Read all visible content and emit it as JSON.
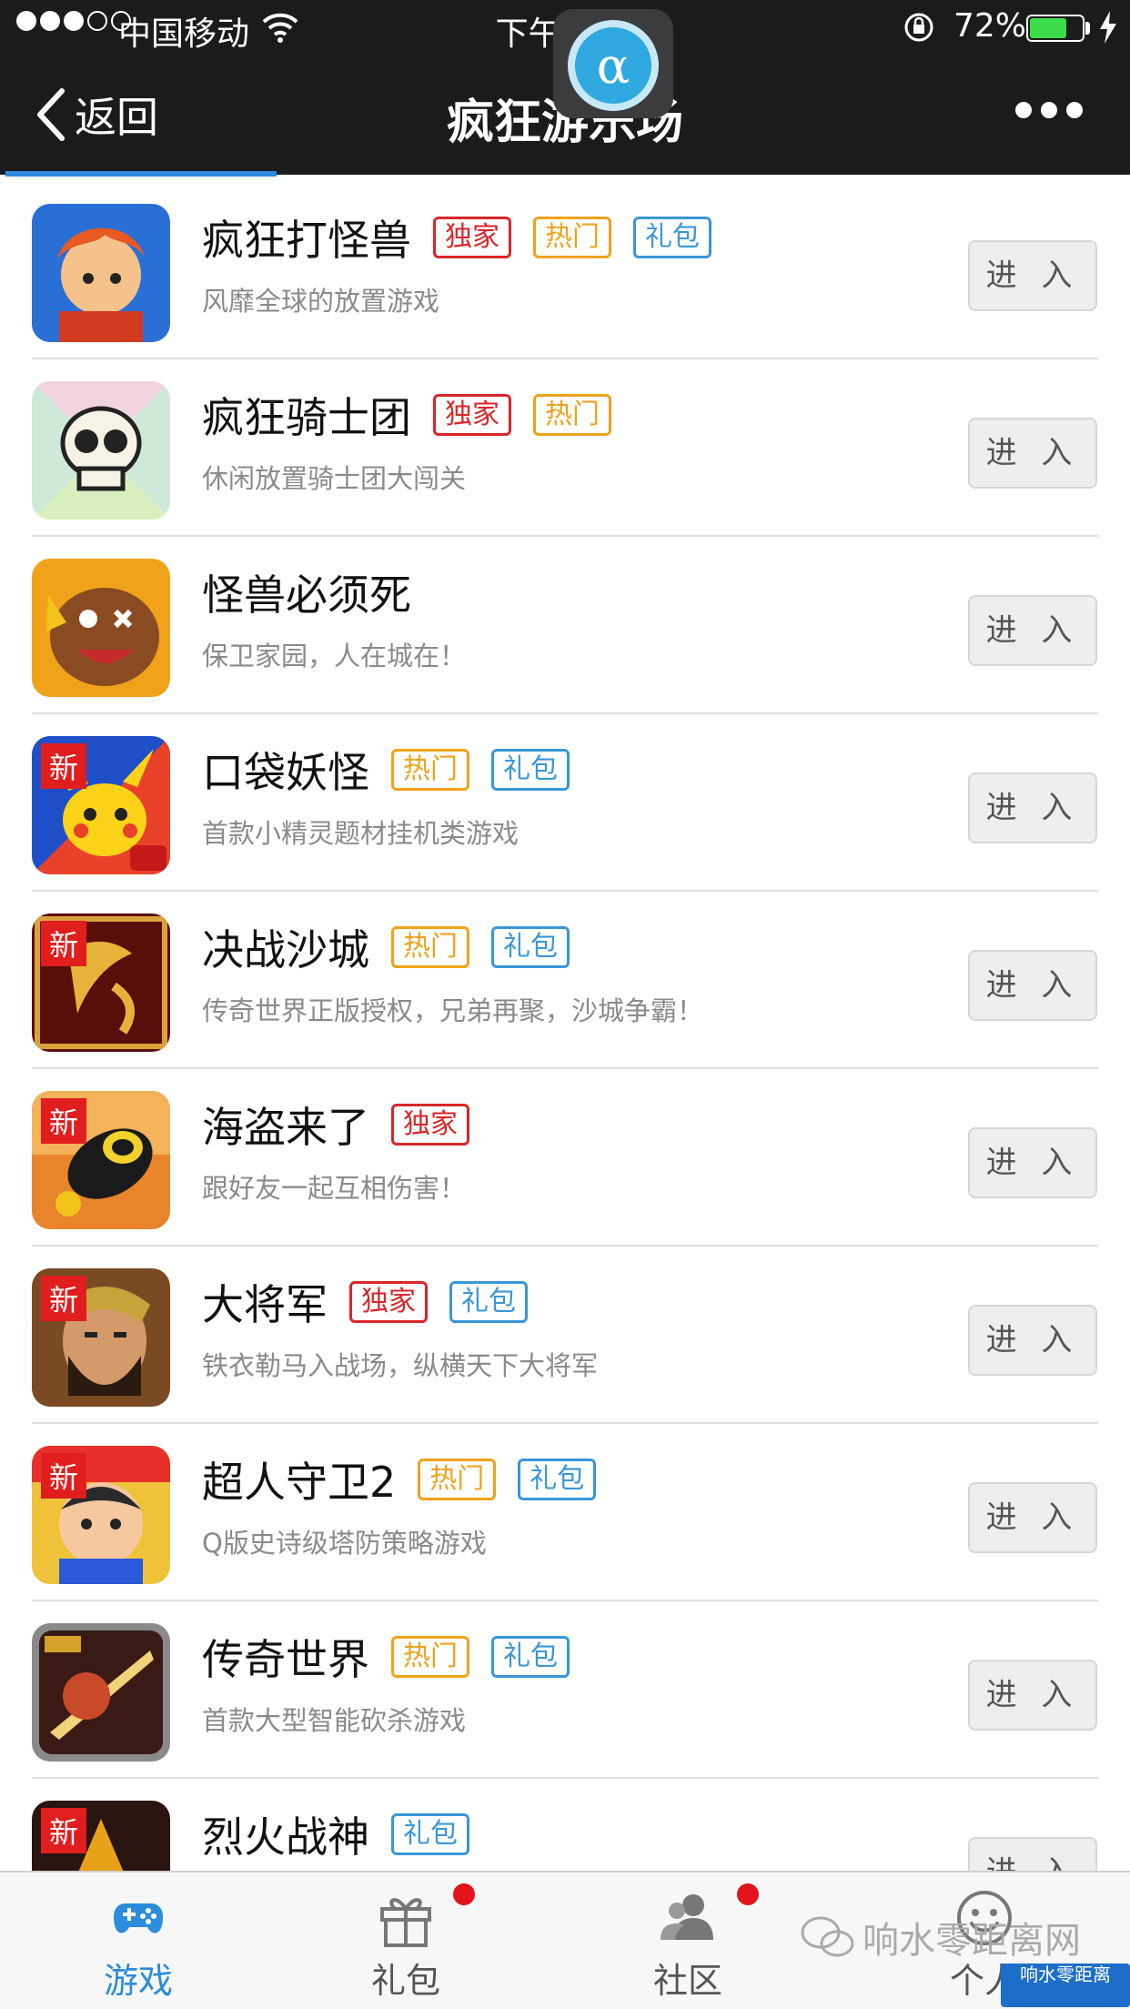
{
  "status_bar": {
    "carrier": "中国移动",
    "time": "下午8:12",
    "battery_percent": "72%",
    "battery_level": 0.72
  },
  "nav": {
    "back_label": "返回",
    "title": "疯狂游乐场"
  },
  "float_button": {
    "glyph": "α"
  },
  "tag_labels": {
    "exclusive": "独家",
    "hot": "热门",
    "gift": "礼包",
    "new": "新"
  },
  "enter_label": "进 入",
  "games": [
    {
      "name": "疯狂打怪兽",
      "desc": "风靡全球的放置游戏",
      "is_new": false,
      "tags": [
        "独家",
        "热门",
        "礼包"
      ]
    },
    {
      "name": "疯狂骑士团",
      "desc": "休闲放置骑士团大闯关",
      "is_new": false,
      "tags": [
        "独家",
        "热门"
      ]
    },
    {
      "name": "怪兽必须死",
      "desc": "保卫家园，人在城在！",
      "is_new": false,
      "tags": []
    },
    {
      "name": "口袋妖怪",
      "desc": "首款小精灵题材挂机类游戏",
      "is_new": true,
      "tags": [
        "热门",
        "礼包"
      ]
    },
    {
      "name": "决战沙城",
      "desc": "传奇世界正版授权，兄弟再聚，沙城争霸！",
      "is_new": true,
      "tags": [
        "热门",
        "礼包"
      ]
    },
    {
      "name": "海盗来了",
      "desc": "跟好友一起互相伤害！",
      "is_new": true,
      "tags": [
        "独家"
      ]
    },
    {
      "name": "大将军",
      "desc": "铁衣勒马入战场，纵横天下大将军",
      "is_new": true,
      "tags": [
        "独家",
        "礼包"
      ]
    },
    {
      "name": "超人守卫2",
      "desc": "Q版史诗级塔防策略游戏",
      "is_new": true,
      "tags": [
        "热门",
        "礼包"
      ]
    },
    {
      "name": "传奇世界",
      "desc": "首款大型智能砍杀游戏",
      "is_new": false,
      "tags": [
        "热门",
        "礼包"
      ]
    },
    {
      "name": "烈火战神",
      "desc": "",
      "is_new": true,
      "tags": [
        "礼包"
      ]
    }
  ],
  "tabbar": {
    "games": "游戏",
    "gifts": "礼包",
    "community": "社区",
    "profile": "个人"
  },
  "watermark": {
    "text": "响水零距离网",
    "logo_text": "响水零距离"
  },
  "colors": {
    "nav_bg": "#1b1b1d",
    "accent_blue": "#2b8ddb",
    "tag_exclusive": "#d8262a",
    "tag_hot": "#efa21a",
    "tag_gift": "#3a96d8",
    "new_tag": "#e01e1e",
    "battery": "#3ddc4a"
  }
}
